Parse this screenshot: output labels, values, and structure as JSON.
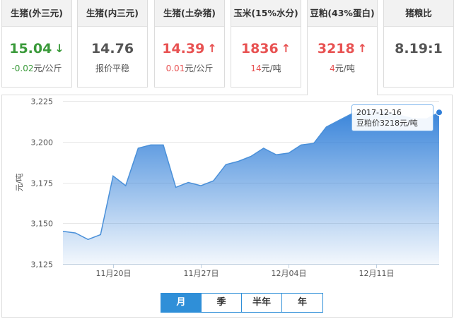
{
  "cards": [
    {
      "title": "生猪(外三元)",
      "value": "15.04",
      "change": "-0.02元/公斤",
      "trend": "down"
    },
    {
      "title": "生猪(内三元)",
      "value": "14.76",
      "change": "报价平稳",
      "trend": "flat"
    },
    {
      "title": "生猪(土杂猪)",
      "value": "14.39",
      "change": "0.01元/公斤",
      "trend": "up"
    },
    {
      "title": "玉米(15%水分)",
      "value": "1836",
      "change": "14元/吨",
      "trend": "up"
    },
    {
      "title": "豆粕(43%蛋白)",
      "value": "3218",
      "change": "4元/吨",
      "trend": "up"
    },
    {
      "title": "猪粮比",
      "value": "8.19:1",
      "change": "",
      "trend": "none"
    }
  ],
  "icons": {
    "down": "arrow-down-icon",
    "up": "arrow-up-icon"
  },
  "colors": {
    "up": "#e85252",
    "down": "#3a9a3a",
    "series": "#2f7ed8",
    "tab_active": "#2f8fd8"
  },
  "tooltip": {
    "date": "2017-12-16",
    "text": "豆粕价3218元/吨"
  },
  "tabs": [
    {
      "label": "月",
      "active": true
    },
    {
      "label": "季",
      "active": false
    },
    {
      "label": "半年",
      "active": false
    },
    {
      "label": "年",
      "active": false
    }
  ],
  "chart_data": {
    "type": "area",
    "ylabel": "元/吨",
    "xlabel": "",
    "ylim": [
      3125,
      3225
    ],
    "yticks": [
      3125,
      3150,
      3175,
      3200,
      3225
    ],
    "ytick_labels": [
      "3,125",
      "3,150",
      "3,175",
      "3,200",
      "3,225"
    ],
    "xticks": [
      {
        "date": "2017-11-20",
        "label": "11月20日"
      },
      {
        "date": "2017-11-27",
        "label": "11月27日"
      },
      {
        "date": "2017-12-04",
        "label": "12月04日"
      },
      {
        "date": "2017-12-11",
        "label": "12月11日"
      }
    ],
    "xlim": [
      "2017-11-16",
      "2017-12-16"
    ],
    "grid": true,
    "series": [
      {
        "values": [
          {
            "x": "2017-11-16",
            "y": 3145
          },
          {
            "x": "2017-11-17",
            "y": 3144
          },
          {
            "x": "2017-11-18",
            "y": 3140
          },
          {
            "x": "2017-11-19",
            "y": 3143
          },
          {
            "x": "2017-11-20",
            "y": 3179
          },
          {
            "x": "2017-11-21",
            "y": 3173
          },
          {
            "x": "2017-11-22",
            "y": 3196
          },
          {
            "x": "2017-11-23",
            "y": 3198
          },
          {
            "x": "2017-11-24",
            "y": 3198
          },
          {
            "x": "2017-11-25",
            "y": 3172
          },
          {
            "x": "2017-11-26",
            "y": 3175
          },
          {
            "x": "2017-11-27",
            "y": 3173
          },
          {
            "x": "2017-11-28",
            "y": 3176
          },
          {
            "x": "2017-11-29",
            "y": 3186
          },
          {
            "x": "2017-11-30",
            "y": 3188
          },
          {
            "x": "2017-12-01",
            "y": 3191
          },
          {
            "x": "2017-12-02",
            "y": 3196
          },
          {
            "x": "2017-12-03",
            "y": 3192
          },
          {
            "x": "2017-12-04",
            "y": 3193
          },
          {
            "x": "2017-12-05",
            "y": 3198
          },
          {
            "x": "2017-12-06",
            "y": 3199
          },
          {
            "x": "2017-12-07",
            "y": 3209
          },
          {
            "x": "2017-12-08",
            "y": 3213
          },
          {
            "x": "2017-12-09",
            "y": 3217
          },
          {
            "x": "2017-12-10",
            "y": 3219
          },
          {
            "x": "2017-12-11",
            "y": 3219
          },
          {
            "x": "2017-12-12",
            "y": 3218
          },
          {
            "x": "2017-12-13",
            "y": 3216
          },
          {
            "x": "2017-12-14",
            "y": 3214
          },
          {
            "x": "2017-12-15",
            "y": 3214
          },
          {
            "x": "2017-12-16",
            "y": 3218
          }
        ]
      }
    ]
  }
}
